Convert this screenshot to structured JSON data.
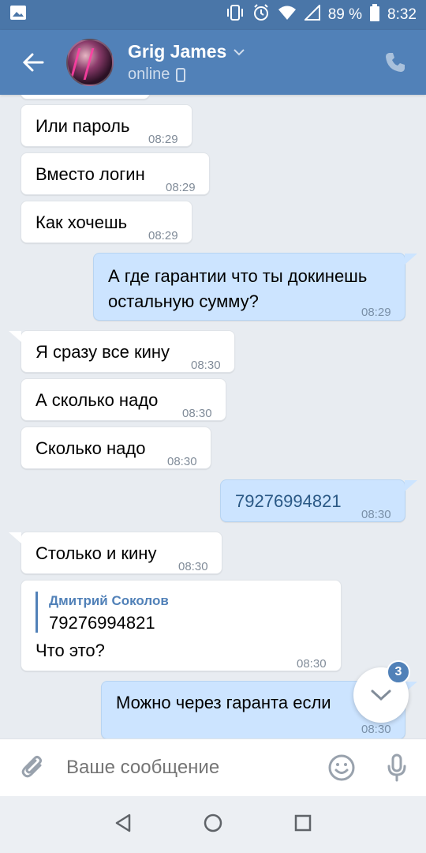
{
  "status_bar": {
    "battery_percent": "89 %",
    "time": "8:32"
  },
  "header": {
    "name": "Grig James",
    "status": "online"
  },
  "messages": [
    {
      "dir": "in",
      "text": "Или пароль",
      "time": "08:29"
    },
    {
      "dir": "in",
      "text": "Вместо логин",
      "time": "08:29"
    },
    {
      "dir": "in",
      "text": "Как хочешь",
      "time": "08:29"
    },
    {
      "dir": "out",
      "text": "А где гарантии что ты докинешь остальную сумму?",
      "time": "08:29"
    },
    {
      "dir": "in",
      "text": "Я сразу все кину",
      "time": "08:30"
    },
    {
      "dir": "in",
      "text": "А сколько надо",
      "time": "08:30"
    },
    {
      "dir": "in",
      "text": "Сколько надо",
      "time": "08:30"
    },
    {
      "dir": "out",
      "text": "79276994821",
      "time": "08:30"
    },
    {
      "dir": "in",
      "text": "Столько и кину",
      "time": "08:30"
    },
    {
      "dir": "in",
      "reply_author": "Дмитрий Соколов",
      "reply_text": "79276994821",
      "text": "Что это?",
      "time": "08:30"
    },
    {
      "dir": "out",
      "text": "Можно через гаранта если",
      "time": "08:30"
    }
  ],
  "scroll_down": {
    "unread_count": "3"
  },
  "composer": {
    "placeholder": "Ваше сообщение"
  },
  "colors": {
    "header": "#5181b8",
    "statusbar": "#4a76a8",
    "background": "#e8ecf1",
    "outgoing": "#cce4ff",
    "incoming": "#ffffff"
  }
}
